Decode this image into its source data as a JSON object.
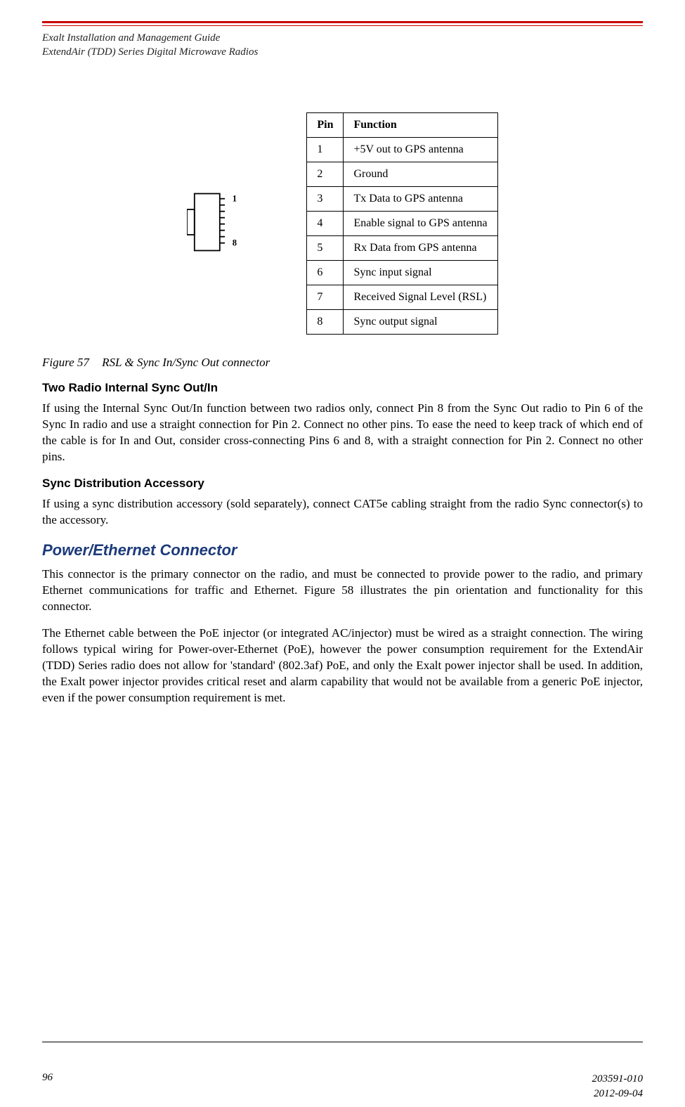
{
  "header": {
    "line1": "Exalt Installation and Management Guide",
    "line2": "ExtendAir (TDD) Series Digital Microwave Radios"
  },
  "connector_labels": {
    "top": "1",
    "bottom": "8"
  },
  "pins_table": {
    "columns": [
      "Pin",
      "Function"
    ],
    "rows": [
      [
        "1",
        "+5V out to GPS antenna"
      ],
      [
        "2",
        "Ground"
      ],
      [
        "3",
        "Tx Data to GPS antenna"
      ],
      [
        "4",
        "Enable signal to GPS antenna"
      ],
      [
        "5",
        "Rx Data from GPS antenna"
      ],
      [
        "6",
        "Sync input signal"
      ],
      [
        "7",
        "Received Signal Level (RSL)"
      ],
      [
        "8",
        "Sync output signal"
      ]
    ]
  },
  "figure": {
    "label": "Figure 57",
    "caption": "RSL & Sync In/Sync Out connector"
  },
  "sections": {
    "two_radio": {
      "title": "Two Radio Internal Sync Out/In",
      "para": "If using the Internal Sync Out/In function between two radios only, connect Pin 8 from the Sync Out radio to Pin 6 of the Sync In radio and use a straight connection for Pin 2. Connect no other pins. To ease the need to keep track of which end of the cable is for In and Out, consider cross-connecting Pins 6 and 8, with a straight connection for Pin 2. Connect no other pins."
    },
    "sync_dist": {
      "title": "Sync Distribution Accessory",
      "para": "If using a sync distribution accessory (sold separately), connect CAT5e cabling straight from the radio Sync connector(s) to the accessory."
    },
    "power_eth": {
      "title": "Power/Ethernet Connector",
      "para1": "This connector is the primary connector on the radio, and must be connected to provide power to the radio, and primary Ethernet communications for traffic and Ethernet. Figure 58 illustrates the pin orientation and functionality for this connector.",
      "para2": "The Ethernet cable between the PoE injector (or integrated AC/injector) must be wired as a straight connection. The wiring follows typical wiring for Power-over-Ethernet (PoE), however the power consumption requirement for the ExtendAir (TDD) Series radio does not allow for 'standard' (802.3af) PoE, and only the Exalt power injector shall be used. In addition, the Exalt power injector provides critical reset and alarm capability that would not be available from a generic PoE injector, even if the power consumption requirement is met."
    }
  },
  "footer": {
    "page": "96",
    "docnum": "203591-010",
    "date": "2012-09-04"
  }
}
